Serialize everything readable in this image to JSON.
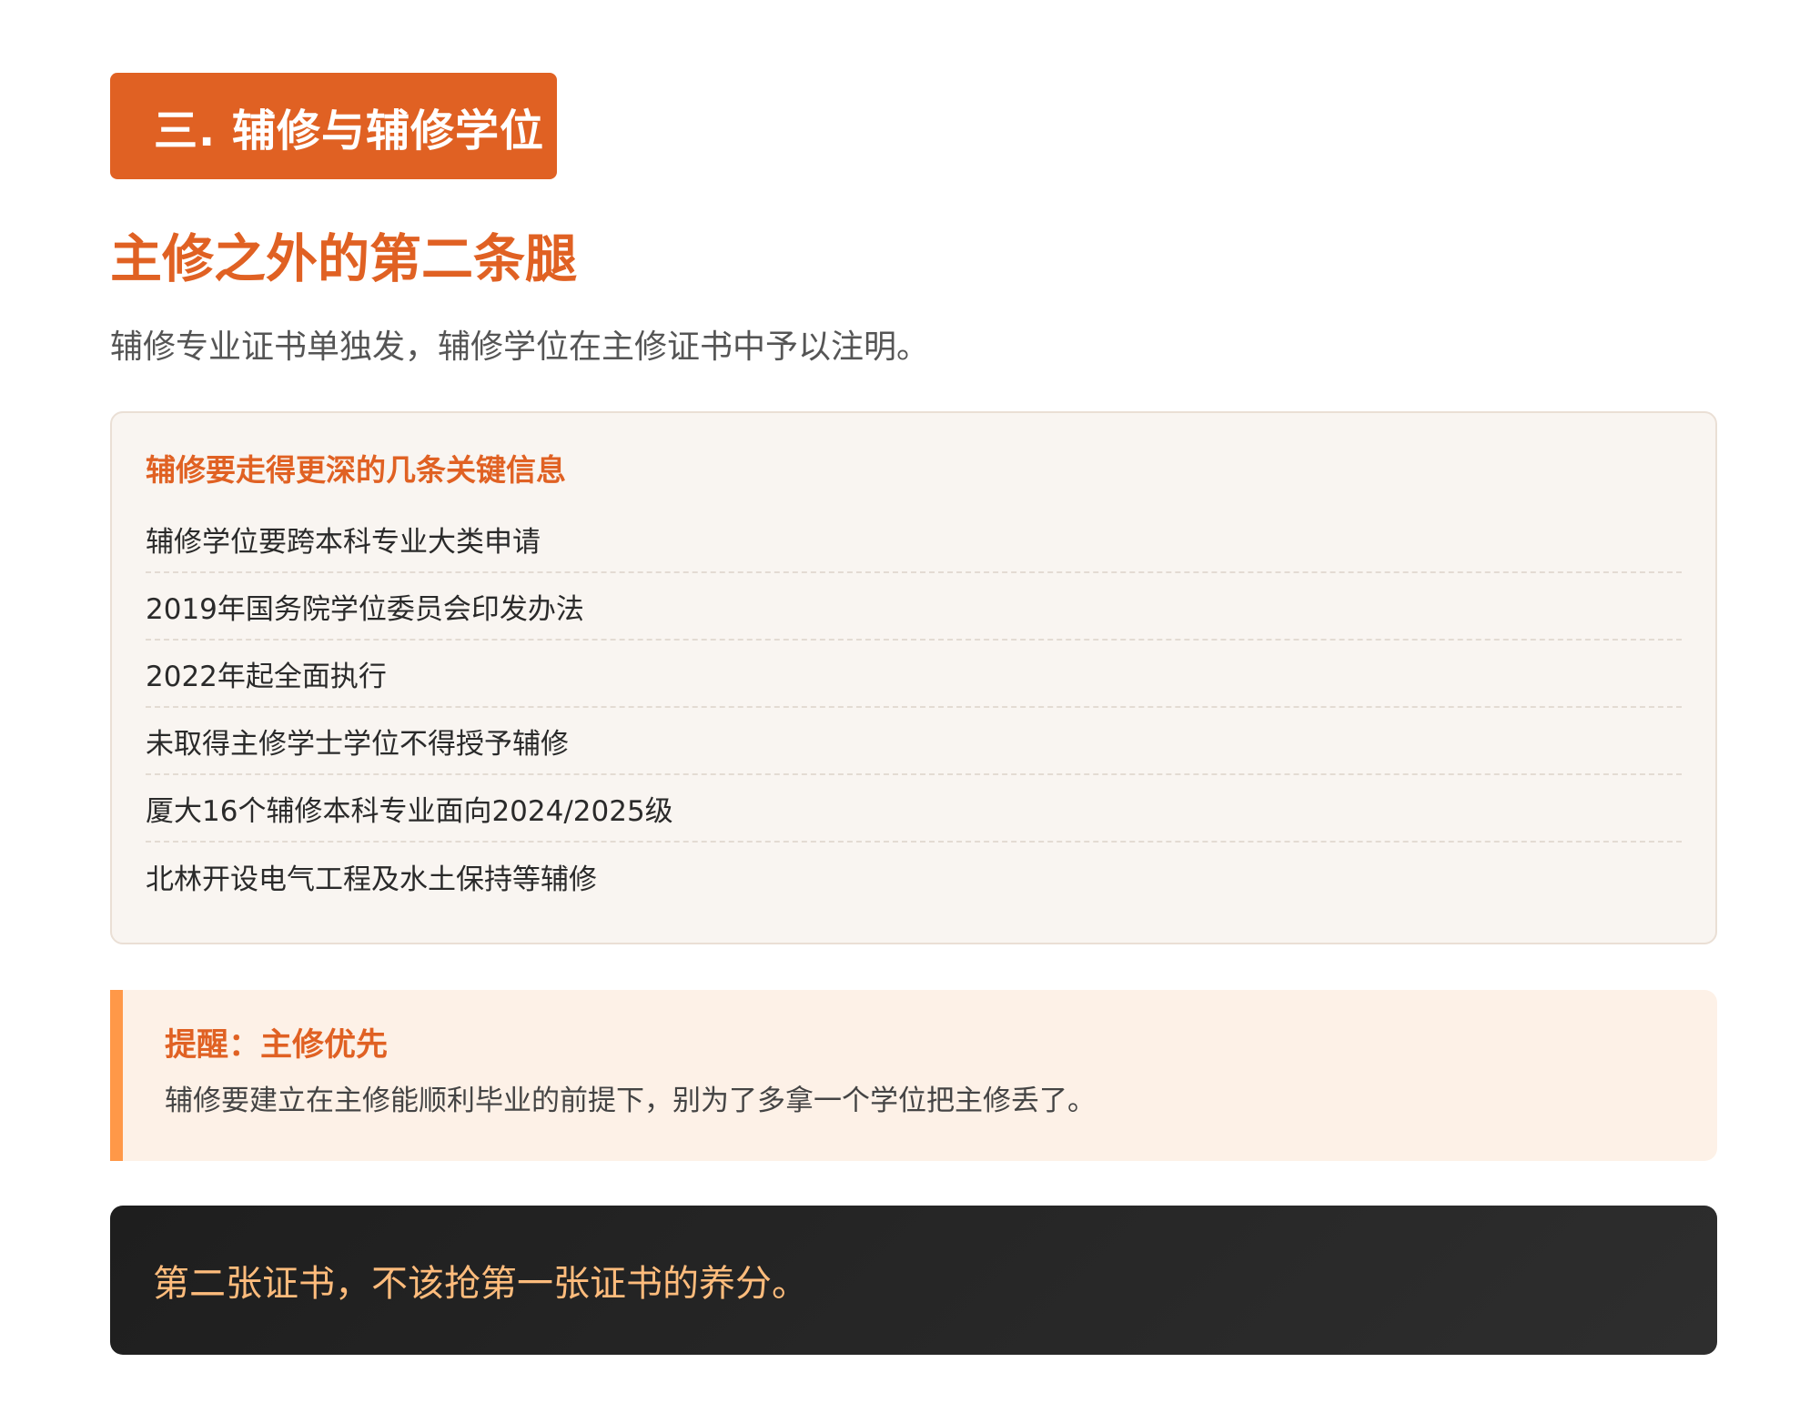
{
  "section": {
    "badge_label": "三. 辅修与辅修学位"
  },
  "heading": "主修之外的第二条腿",
  "lead": "辅修专业证书单独发，辅修学位在主修证书中予以注明。",
  "info_card": {
    "title": "辅修要走得更深的几条关键信息",
    "items": [
      "辅修学位要跨本科专业大类申请",
      "2019年国务院学位委员会印发办法",
      "2022年起全面执行",
      "未取得主修学士学位不得授予辅修",
      "厦大16个辅修本科专业面向2024/2025级",
      "北林开设电气工程及水土保持等辅修"
    ]
  },
  "reminder": {
    "title": "提醒：主修优先",
    "text": "辅修要建立在主修能顺利毕业的前提下，别为了多拿一个学位把主修丢了。"
  },
  "quote": "第二张证书，不该抢第一张证书的养分。",
  "colors": {
    "accent": "#e06123",
    "reminder_bar": "#ff9848",
    "quote_text": "#ffbc7c"
  }
}
